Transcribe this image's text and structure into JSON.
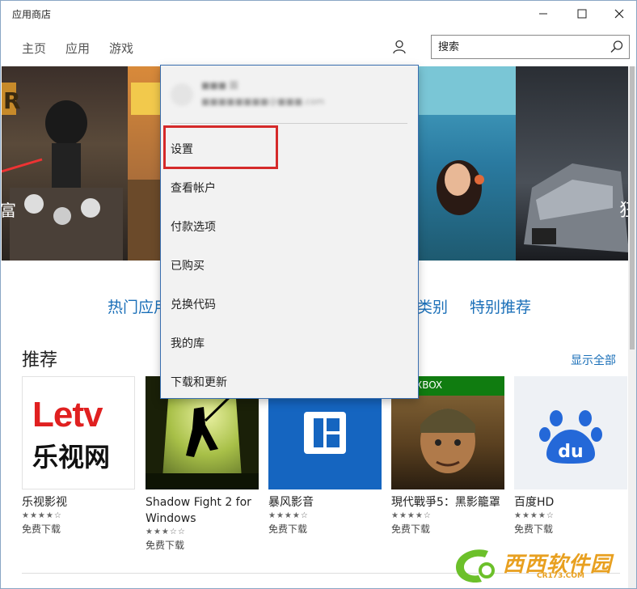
{
  "window": {
    "title": "应用商店",
    "minimize": "—",
    "maximize": "☐",
    "close": "✕"
  },
  "nav": {
    "items": [
      "主页",
      "应用",
      "游戏"
    ]
  },
  "search": {
    "placeholder": "搜索"
  },
  "categories": {
    "hot": "热门应用",
    "category": "类别",
    "featured": "特别推荐"
  },
  "section": {
    "title": "推荐",
    "show_all": "显示全部"
  },
  "apps": [
    {
      "name": "乐视影视",
      "stars": "★★★★☆",
      "price": "免费下载",
      "brand": "Letv",
      "sub": "乐视网"
    },
    {
      "name": "Shadow Fight 2 for Windows",
      "stars": "★★★☆☆",
      "price": "免费下载"
    },
    {
      "name": "暴风影音",
      "stars": "★★★★☆",
      "price": "免费下载"
    },
    {
      "name": "現代戰爭5：黑影籠罩",
      "stars": "★★★★☆",
      "price": "免费下载",
      "badge": "XBOX"
    },
    {
      "name": "百度HD",
      "stars": "★★★★☆",
      "price": "免费下载",
      "logo": "du"
    }
  ],
  "hero": {
    "left_text": "R",
    "left_edge": "富",
    "right_edge": "狂"
  },
  "flyout": {
    "account_name": "■■■ 圖",
    "account_email": "■■■■■■■■@■■■.com",
    "items": [
      "设置",
      "查看帐户",
      "付款选项",
      "已购买",
      "兑换代码",
      "我的库",
      "下载和更新"
    ]
  },
  "watermark": {
    "text": "西西软件园",
    "url": "CR173.COM"
  },
  "colors": {
    "accent": "#1a6fb8",
    "highlight": "#d52a2a",
    "flyout_border": "#3a6fb0"
  }
}
